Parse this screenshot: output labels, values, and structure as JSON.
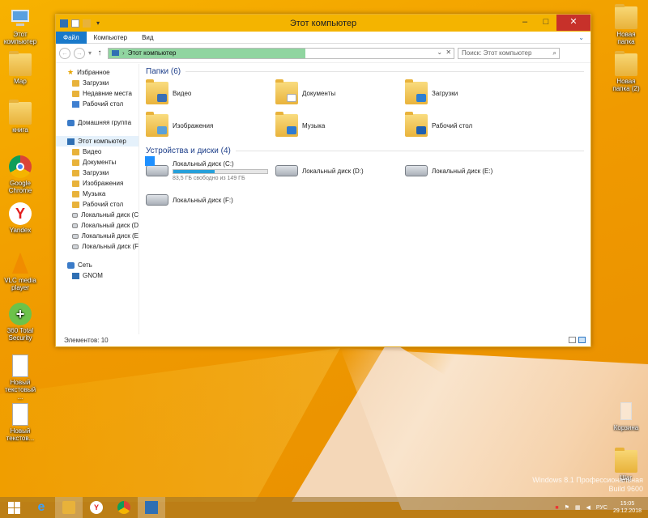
{
  "desktop_icons": [
    {
      "label": "Этот компьютер",
      "icon": "computer-icon"
    },
    {
      "label": "Мар",
      "icon": "user-folder-icon"
    },
    {
      "label": "книга",
      "icon": "folder-icon"
    },
    {
      "label": "Google Chrome",
      "icon": "chrome-icon"
    },
    {
      "label": "Yandex",
      "icon": "yandex-icon"
    },
    {
      "label": "VLC media player",
      "icon": "vlc-icon"
    },
    {
      "label": "360 Total Security",
      "icon": "360-icon"
    },
    {
      "label": "Новый текстовый ...",
      "icon": "text-document-icon"
    },
    {
      "label": "Новый текстов...",
      "icon": "text-document-icon"
    },
    {
      "label": "Новая папка",
      "icon": "folder-icon"
    },
    {
      "label": "Новая папка (2)",
      "icon": "folder-icon"
    },
    {
      "label": "Корзина",
      "icon": "recycle-bin-icon"
    },
    {
      "label": "Шаг",
      "icon": "folder-icon"
    }
  ],
  "window": {
    "title": "Этот компьютер",
    "controls": {
      "minimize": "–",
      "maximize": "□",
      "close": "✕"
    }
  },
  "ribbon": {
    "tabs": [
      "Файл",
      "Компьютер",
      "Вид"
    ],
    "expand": "⌄"
  },
  "address": {
    "path": "Этот компьютер",
    "search_placeholder": "Поиск: Этот компьютер"
  },
  "nav": {
    "favorites": "Избранное",
    "fav_items": [
      "Загрузки",
      "Недавние места",
      "Рабочий стол"
    ],
    "homegroup": "Домашняя группа",
    "this_pc": "Этот компьютер",
    "pc_items": [
      "Видео",
      "Документы",
      "Загрузки",
      "Изображения",
      "Музыка",
      "Рабочий стол",
      "Локальный диск (C",
      "Локальный диск (D",
      "Локальный диск (E",
      "Локальный диск (F"
    ],
    "network": "Сеть",
    "network_items": [
      "GNOM"
    ]
  },
  "folders_header": "Папки (6)",
  "folders": [
    {
      "name": "Видео",
      "icon": "video-folder-icon"
    },
    {
      "name": "Документы",
      "icon": "documents-folder-icon"
    },
    {
      "name": "Загрузки",
      "icon": "downloads-folder-icon"
    },
    {
      "name": "Изображения",
      "icon": "pictures-folder-icon"
    },
    {
      "name": "Музыка",
      "icon": "music-folder-icon"
    },
    {
      "name": "Рабочий стол",
      "icon": "desktop-folder-icon"
    }
  ],
  "drives_header": "Устройства и диски (4)",
  "drives": [
    {
      "name": "Локальный диск (C:)",
      "free_text": "83,5 ГБ свободно из 149 ГБ",
      "used_fraction": 0.44
    },
    {
      "name": "Локальный диск (D:)"
    },
    {
      "name": "Локальный диск (E:)"
    },
    {
      "name": "Локальный диск (F:)"
    }
  ],
  "status": {
    "items": "Элементов: 10"
  },
  "taskbar": {
    "apps": [
      "start-icon",
      "internet-explorer-icon",
      "file-explorer-icon",
      "yandex-icon",
      "chrome-icon",
      "network-icon"
    ],
    "tray_lang": "РУС",
    "time": "15:05",
    "date": "29.12.2018"
  },
  "watermark": {
    "line1": "Windows 8.1 Профессиональная",
    "line2": "Build 9600"
  }
}
